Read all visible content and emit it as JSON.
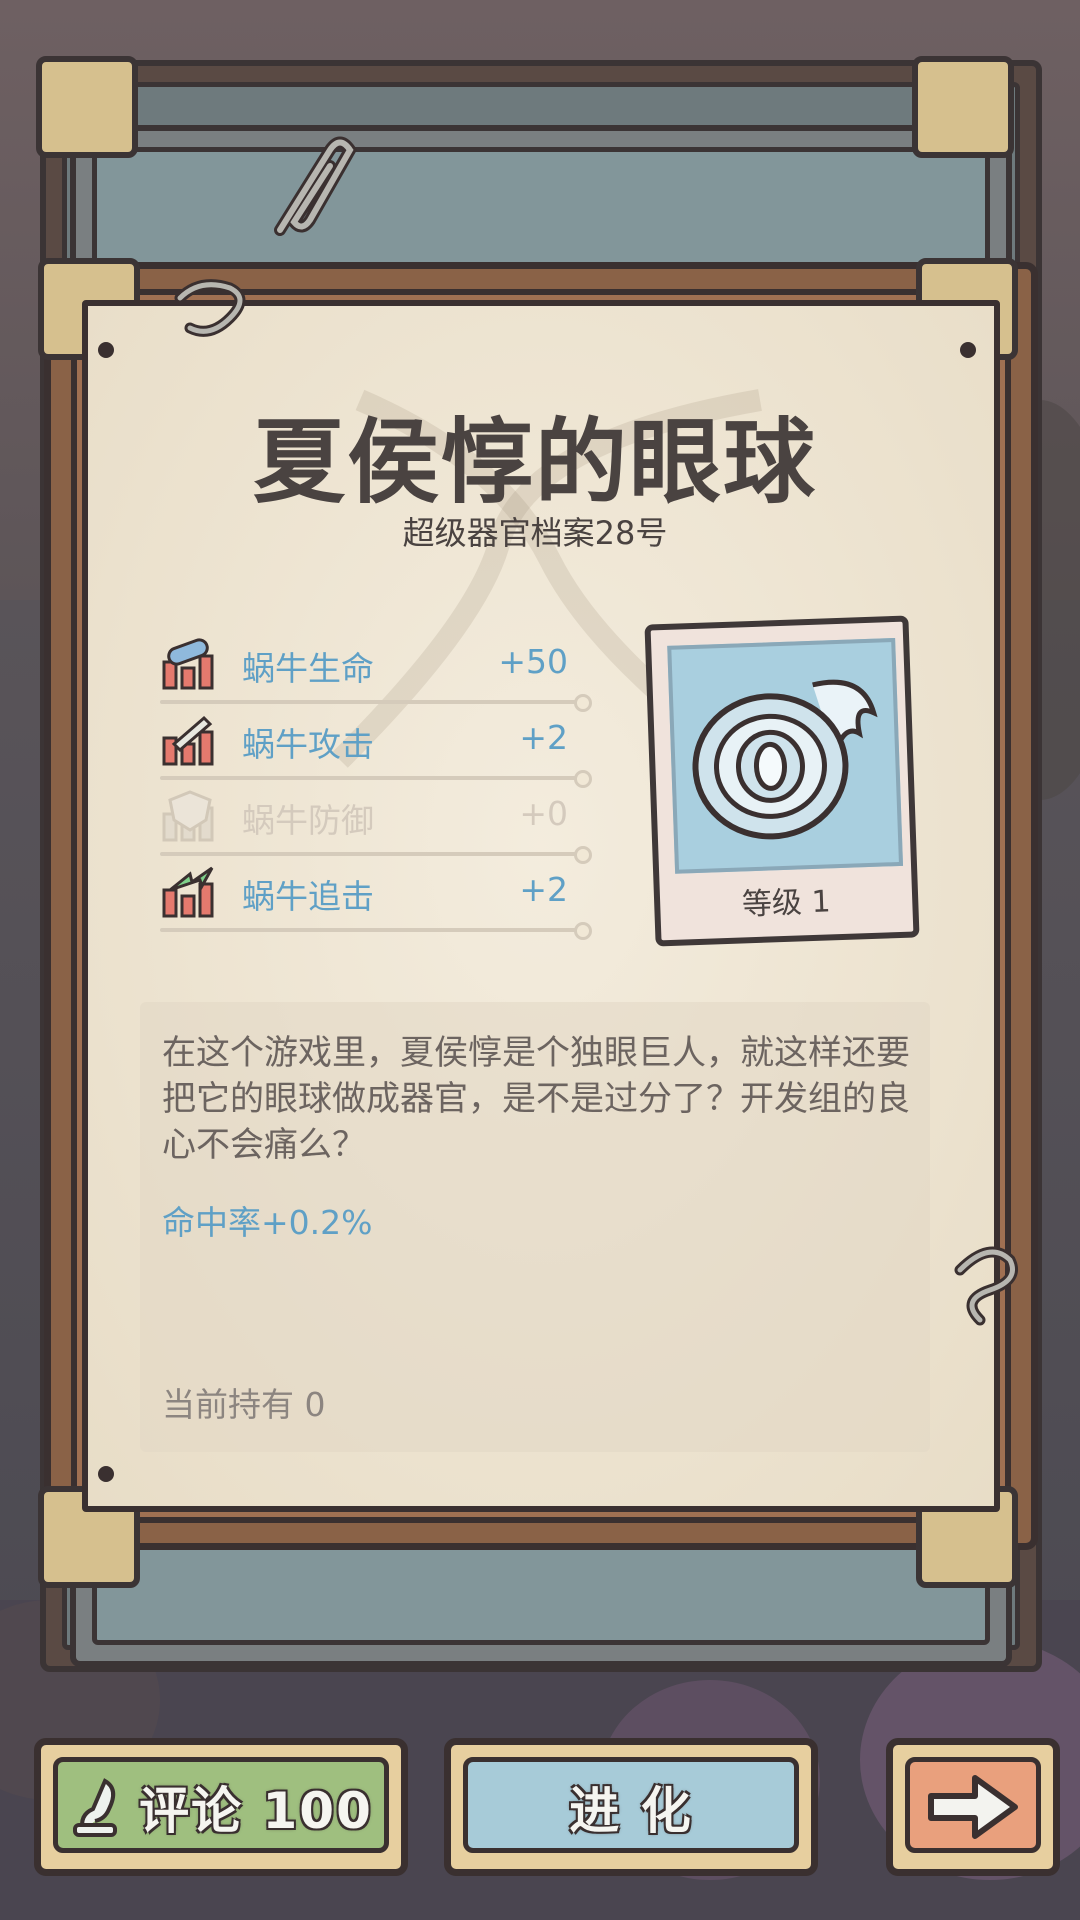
{
  "organ": {
    "title": "夏侯惇的眼球",
    "subtitle": "超级器官档案28号",
    "level_label": "等级 1"
  },
  "stats": [
    {
      "label": "蜗牛生命",
      "value": "+50",
      "icon": "health-icon",
      "active": true
    },
    {
      "label": "蜗牛攻击",
      "value": "+2",
      "icon": "attack-icon",
      "active": true
    },
    {
      "label": "蜗牛防御",
      "value": "+0",
      "icon": "defense-icon",
      "active": false
    },
    {
      "label": "蜗牛追击",
      "value": "+2",
      "icon": "pursuit-icon",
      "active": true
    }
  ],
  "description": {
    "text": "在这个游戏里，夏侯惇是个独眼巨人，就这样还要把它的眼球做成器官，是不是过分了？开发组的良心不会痛么？",
    "effect": "命中率+0.2%",
    "owned": "当前持有  0"
  },
  "buttons": {
    "comment": "评论 100",
    "evolve": "进 化"
  },
  "colors": {
    "stat_blue": "#5fa0c6",
    "paper": "#f1e8d6",
    "frame": "#8a6247"
  }
}
